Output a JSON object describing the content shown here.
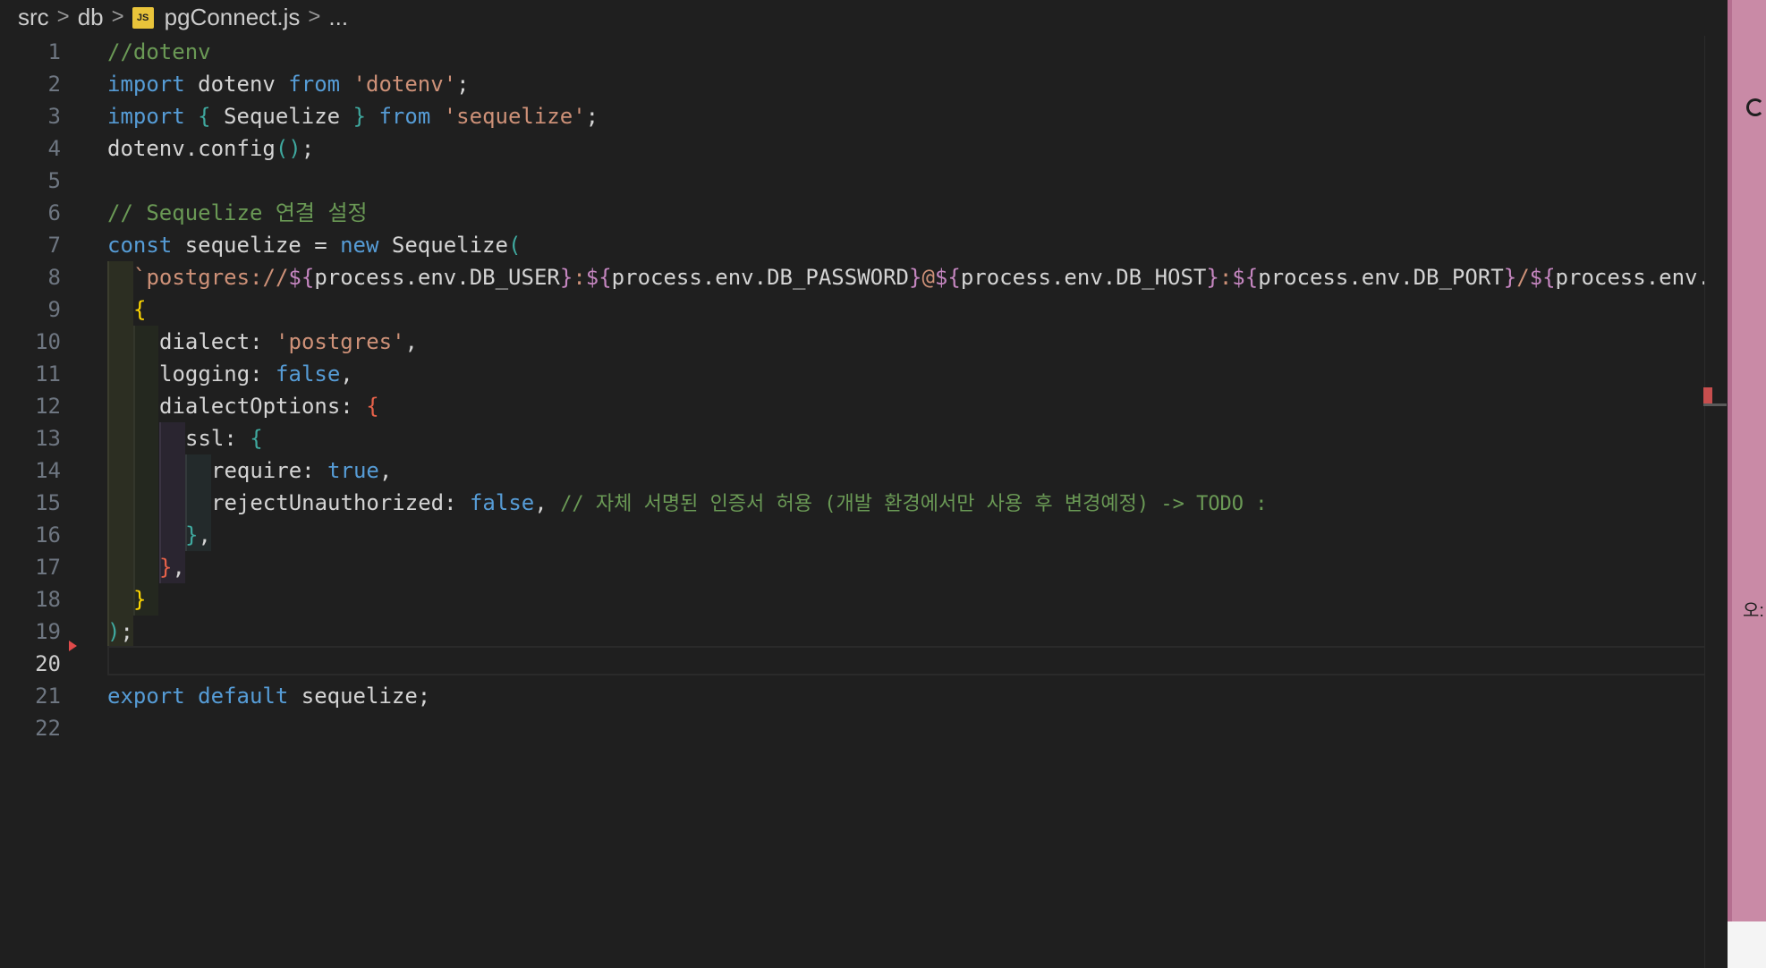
{
  "breadcrumb": {
    "items": [
      "src",
      "db",
      "pgConnect.js",
      "..."
    ],
    "file_icon": "JS",
    "separator": ">"
  },
  "editor": {
    "active_line": 20,
    "lines": [
      {
        "num": "1"
      },
      {
        "num": "2"
      },
      {
        "num": "3"
      },
      {
        "num": "4"
      },
      {
        "num": "5"
      },
      {
        "num": "6"
      },
      {
        "num": "7"
      },
      {
        "num": "8"
      },
      {
        "num": "9"
      },
      {
        "num": "10"
      },
      {
        "num": "11"
      },
      {
        "num": "12"
      },
      {
        "num": "13"
      },
      {
        "num": "14"
      },
      {
        "num": "15"
      },
      {
        "num": "16"
      },
      {
        "num": "17"
      },
      {
        "num": "18"
      },
      {
        "num": "19"
      },
      {
        "num": "20"
      },
      {
        "num": "21"
      },
      {
        "num": "22"
      }
    ],
    "code": {
      "l1_comment": "//dotenv",
      "l2_import": "import",
      "l2_name": " dotenv ",
      "l2_from": "from",
      "l2_str": " 'dotenv'",
      "l2_semi": ";",
      "l3_import": "import",
      "l3_brace_open": " {",
      "l3_name": " Sequelize ",
      "l3_brace_close": "}",
      "l3_from": " from",
      "l3_str": " 'sequelize'",
      "l3_semi": ";",
      "l4_text": "dotenv.config",
      "l4_paren": "()",
      "l4_semi": ";",
      "l6_comment": "// Sequelize 연결 설정",
      "l7_const": "const",
      "l7_name": " sequelize = ",
      "l7_new": "new",
      "l7_class": " Sequelize",
      "l7_paren": "(",
      "l8_tick": "`",
      "l8_proto": "postgres://",
      "l8_o1": "${",
      "l8_v1": "process.env.DB_USER",
      "l8_c1": "}",
      "l8_colon1": ":",
      "l8_o2": "${",
      "l8_v2": "process.env.DB_PASSWORD",
      "l8_c2": "}",
      "l8_at": "@",
      "l8_o3": "${",
      "l8_v3": "process.env.DB_HOST",
      "l8_c3": "}",
      "l8_colon2": ":",
      "l8_o4": "${",
      "l8_v4": "process.env.DB_PORT",
      "l8_c4": "}",
      "l8_slash": "/",
      "l8_o5": "${",
      "l8_v5": "process.env.DB",
      "l9_brace": "{",
      "l10_key": "dialect: ",
      "l10_str": "'postgres'",
      "l10_comma": ",",
      "l11_key": "logging: ",
      "l11_val": "false",
      "l11_comma": ",",
      "l12_key": "dialectOptions: ",
      "l12_brace": "{",
      "l13_key": "ssl: ",
      "l13_brace": "{",
      "l14_key": "require: ",
      "l14_val": "true",
      "l14_comma": ",",
      "l15_key": "rejectUnauthorized: ",
      "l15_val": "false",
      "l15_comma": ", ",
      "l15_comment": "// 자체 서명된 인증서 허용 (개발 환경에서만 사용 후 변경예정) -> TODO :",
      "l16_brace": "}",
      "l16_comma": ",",
      "l17_brace": "}",
      "l17_comma": ",",
      "l18_brace": "}",
      "l19_paren": ")",
      "l19_semi": ";",
      "l21_export": "export",
      "l21_default": " default",
      "l21_name": " sequelize;"
    }
  },
  "side_panel": {
    "text": "오:"
  },
  "colors": {
    "background": "#1f1f1f",
    "keyword": "#569cd6",
    "string": "#ce9178",
    "comment": "#6a9955",
    "template_brace": "#c586c0",
    "bracket_gold": "#ffd700",
    "side_panel": "#c98aa6"
  }
}
